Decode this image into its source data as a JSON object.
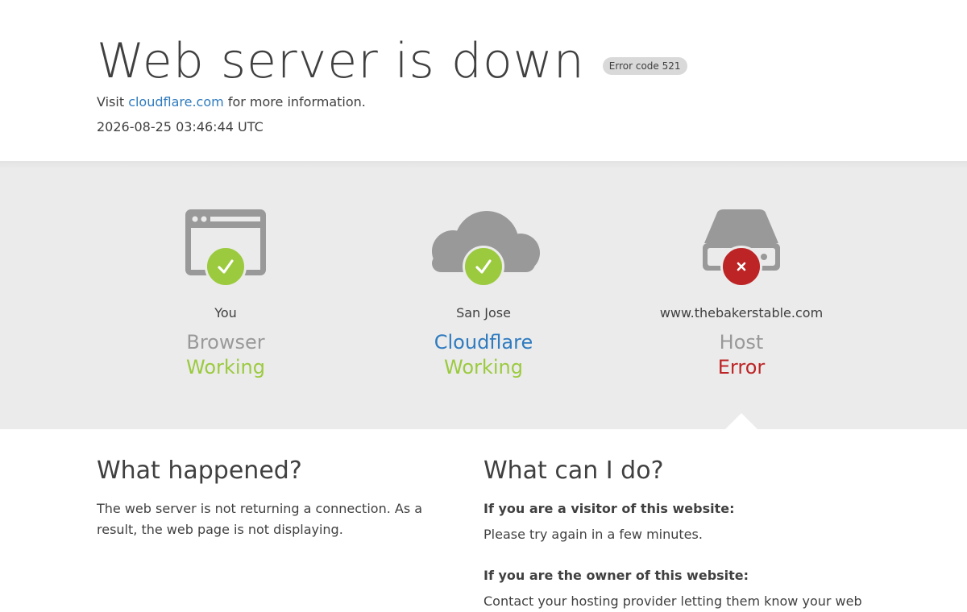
{
  "header": {
    "title": "Web server is down",
    "error_badge": "Error code 521",
    "visit_prefix": "Visit ",
    "visit_link": "cloudflare.com",
    "visit_suffix": " for more information.",
    "timestamp": "2026-08-25 03:46:44 UTC"
  },
  "status": {
    "browser": {
      "icon": "browser-icon",
      "location": "You",
      "role": "Browser",
      "state": "Working",
      "status_icon": "check-icon"
    },
    "cloudflare": {
      "icon": "cloud-icon",
      "location": "San Jose",
      "role": "Cloudflare",
      "state": "Working",
      "status_icon": "check-icon"
    },
    "host": {
      "icon": "server-icon",
      "location": "www.thebakerstable.com",
      "role": "Host",
      "state": "Error",
      "status_icon": "x-icon"
    }
  },
  "what_happened": {
    "title": "What happened?",
    "body": "The web server is not returning a connection. As a result, the web page is not displaying."
  },
  "what_can_i_do": {
    "title": "What can I do?",
    "visitor_heading": "If you are a visitor of this website:",
    "visitor_body": "Please try again in a few minutes.",
    "owner_heading": "If you are the owner of this website:",
    "owner_body": "Contact your hosting provider letting them know your web"
  },
  "colors": {
    "ok": "#9bca3e",
    "error": "#bd2426",
    "link": "#2f7bbf",
    "icon_gray": "#999999",
    "band": "#ebebeb"
  }
}
